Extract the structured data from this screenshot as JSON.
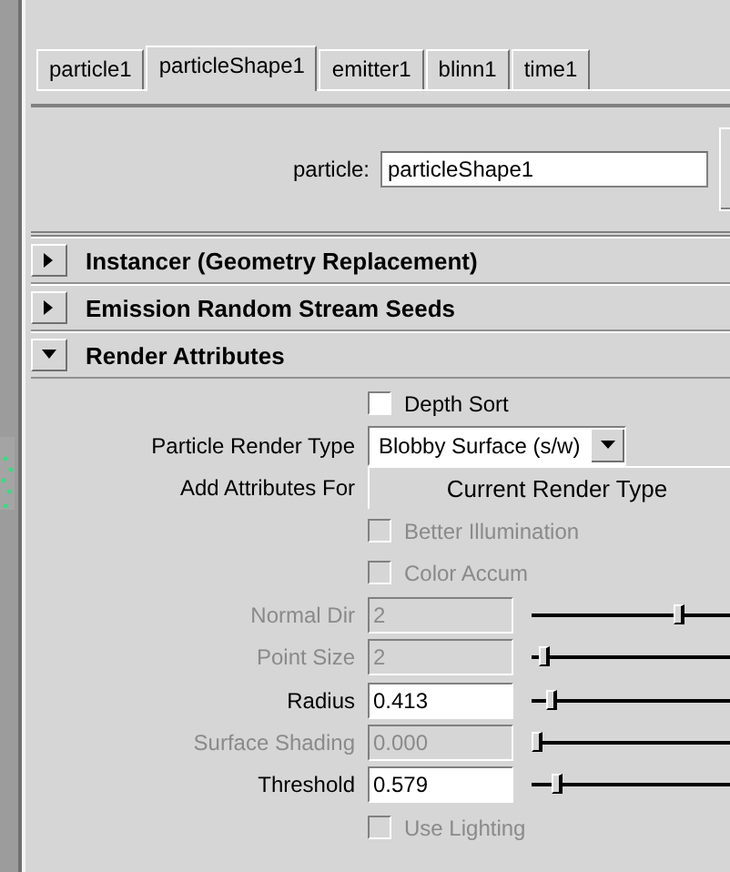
{
  "tabs": [
    {
      "label": "particle1",
      "selected": false
    },
    {
      "label": "particleShape1",
      "selected": true
    },
    {
      "label": "emitter1",
      "selected": false
    },
    {
      "label": "blinn1",
      "selected": false
    },
    {
      "label": "time1",
      "selected": false
    }
  ],
  "node": {
    "label": "particle:",
    "value": "particleShape1"
  },
  "sections": [
    {
      "title": "Instancer (Geometry Replacement)",
      "expanded": false
    },
    {
      "title": "Emission Random Stream Seeds",
      "expanded": false
    },
    {
      "title": "Render Attributes",
      "expanded": true
    }
  ],
  "attributes": [
    {
      "kind": "checkbox",
      "label": "Depth Sort",
      "checked": false,
      "disabled": false
    },
    {
      "kind": "dropdown",
      "label": "Particle Render Type",
      "value": "Blobby Surface (s/w)"
    },
    {
      "kind": "button",
      "label": "Add Attributes For",
      "value": "Current Render Type"
    },
    {
      "kind": "checkbox",
      "label": "Better Illumination",
      "checked": false,
      "disabled": true
    },
    {
      "kind": "checkbox",
      "label": "Color Accum",
      "checked": false,
      "disabled": true
    },
    {
      "kind": "slider",
      "label": "Normal Dir",
      "value": "2",
      "disabled": true,
      "level": 0.56
    },
    {
      "kind": "slider",
      "label": "Point Size",
      "value": "2",
      "disabled": true,
      "level": 0.03
    },
    {
      "kind": "slider",
      "label": "Radius",
      "value": "0.413",
      "disabled": false,
      "level": 0.06
    },
    {
      "kind": "slider",
      "label": "Surface Shading",
      "value": "0.000",
      "disabled": true,
      "level": 0.0
    },
    {
      "kind": "slider",
      "label": "Threshold",
      "value": "0.579",
      "disabled": false,
      "level": 0.08
    },
    {
      "kind": "checkbox",
      "label": "Use Lighting",
      "checked": false,
      "disabled": true
    }
  ]
}
